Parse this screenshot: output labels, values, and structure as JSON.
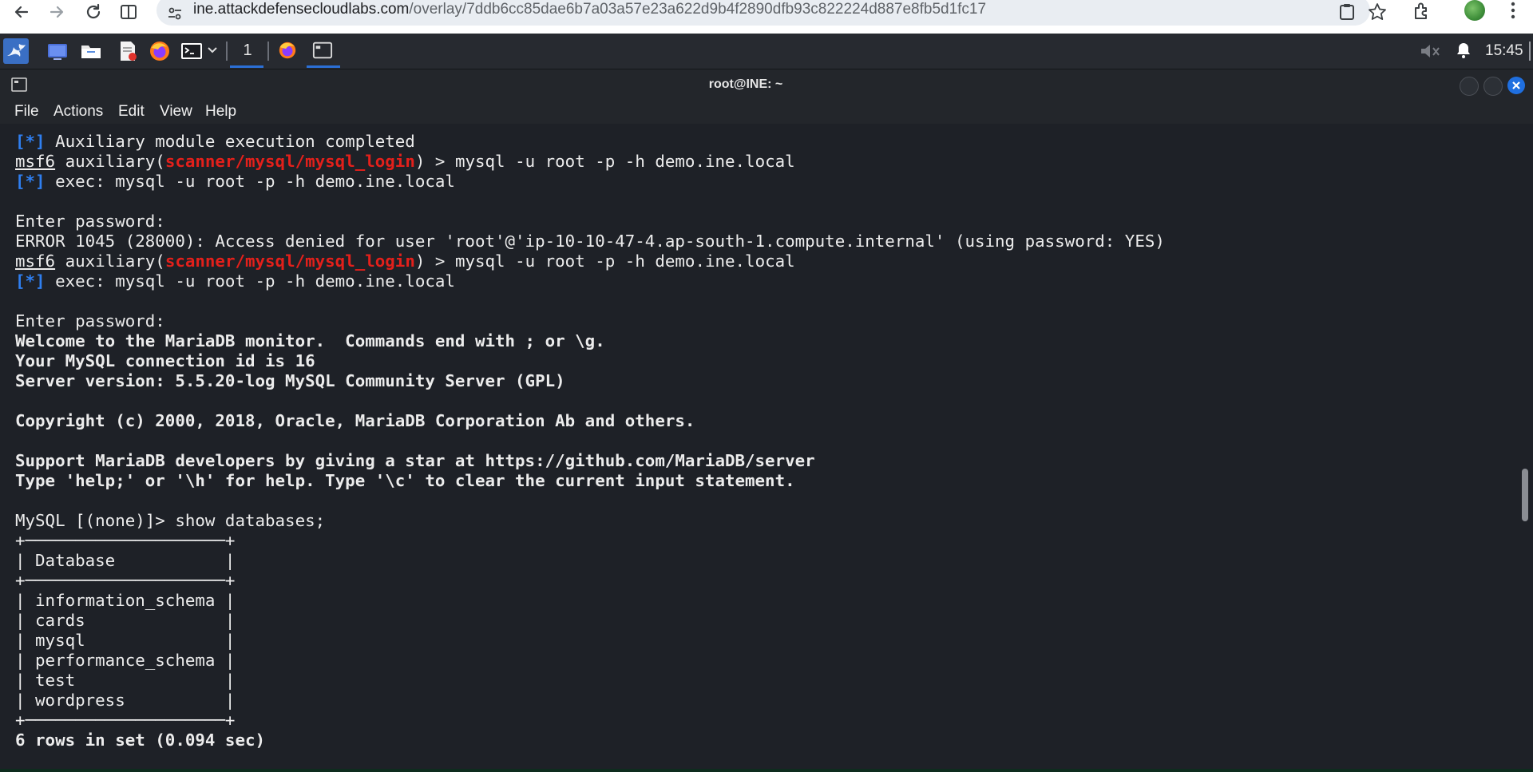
{
  "browser": {
    "url_host": "ine.attackdefensecloudlabs.com",
    "url_path": "/overlay/7ddb6cc85dae6b7a03a57e23a622d9b4f2890dfb93c822224d887e8fb5d1fc17",
    "icons": [
      "back-icon",
      "forward-icon",
      "reload-icon",
      "split-view-icon",
      "site-settings-icon",
      "clipboard-icon",
      "star-icon",
      "extensions-icon",
      "profile-avatar",
      "more-menu-icon"
    ]
  },
  "panel": {
    "workspace": "1",
    "clock": "15:45",
    "icons": [
      "kali-menu-icon",
      "desktop-icon",
      "file-manager-icon",
      "text-editor-icon",
      "firefox-icon",
      "terminal-icon",
      "dropdown-chevron-icon",
      "muted-speaker-icon",
      "notifications-bell-icon"
    ]
  },
  "terminal": {
    "title": "root@INE: ~",
    "menu": [
      "File",
      "Actions",
      "Edit",
      "View",
      "Help"
    ],
    "prompt_user": "msf6",
    "module_path": "scanner/mysql/mysql_login",
    "lines": [
      {
        "t": "plain",
        "star": "[*]",
        "text": " Auxiliary module execution completed"
      },
      {
        "t": "prompt",
        "pre": " auxiliary(",
        "post": ") > mysql -u root -p -h demo.ine.local"
      },
      {
        "t": "plain",
        "star": "[*]",
        "text": " exec: mysql -u root -p -h demo.ine.local"
      },
      {
        "t": "text",
        "text": ""
      },
      {
        "t": "text",
        "text": "Enter password:"
      },
      {
        "t": "text",
        "text": "ERROR 1045 (28000): Access denied for user 'root'@'ip-10-10-47-4.ap-south-1.compute.internal' (using password: YES)"
      },
      {
        "t": "prompt",
        "pre": " auxiliary(",
        "post": ") > mysql -u root -p -h demo.ine.local"
      },
      {
        "t": "plain",
        "star": "[*]",
        "text": " exec: mysql -u root -p -h demo.ine.local"
      },
      {
        "t": "text",
        "text": ""
      },
      {
        "t": "text",
        "text": "Enter password:"
      },
      {
        "t": "bold",
        "text": "Welcome to the MariaDB monitor.  Commands end with ; or \\g."
      },
      {
        "t": "bold",
        "text": "Your MySQL connection id is 16"
      },
      {
        "t": "bold",
        "text": "Server version: 5.5.20-log MySQL Community Server (GPL)"
      },
      {
        "t": "text",
        "text": ""
      },
      {
        "t": "bold",
        "text": "Copyright (c) 2000, 2018, Oracle, MariaDB Corporation Ab and others."
      },
      {
        "t": "text",
        "text": ""
      },
      {
        "t": "bold",
        "text": "Support MariaDB developers by giving a star at https://github.com/MariaDB/server"
      },
      {
        "t": "bold",
        "text": "Type 'help;' or '\\h' for help. Type '\\c' to clear the current input statement."
      },
      {
        "t": "text",
        "text": ""
      },
      {
        "t": "text",
        "text": "MySQL [(none)]> show databases;"
      },
      {
        "t": "text",
        "text": "+────────────────────+"
      },
      {
        "t": "text",
        "text": "| Database           |"
      },
      {
        "t": "text",
        "text": "+────────────────────+"
      },
      {
        "t": "text",
        "text": "| information_schema |"
      },
      {
        "t": "text",
        "text": "| cards              |"
      },
      {
        "t": "text",
        "text": "| mysql              |"
      },
      {
        "t": "text",
        "text": "| performance_schema |"
      },
      {
        "t": "text",
        "text": "| test               |"
      },
      {
        "t": "text",
        "text": "| wordpress          |"
      },
      {
        "t": "text",
        "text": "+────────────────────+"
      },
      {
        "t": "bold",
        "text": "6 rows in set (0.094 sec)"
      }
    ]
  },
  "colors": {
    "terminal_bg": "#1e2127",
    "info_star": "#2f7ff0",
    "module_red": "#e3201b",
    "panel_bg": "#272a30",
    "accent_blue": "#2b6fd6"
  }
}
